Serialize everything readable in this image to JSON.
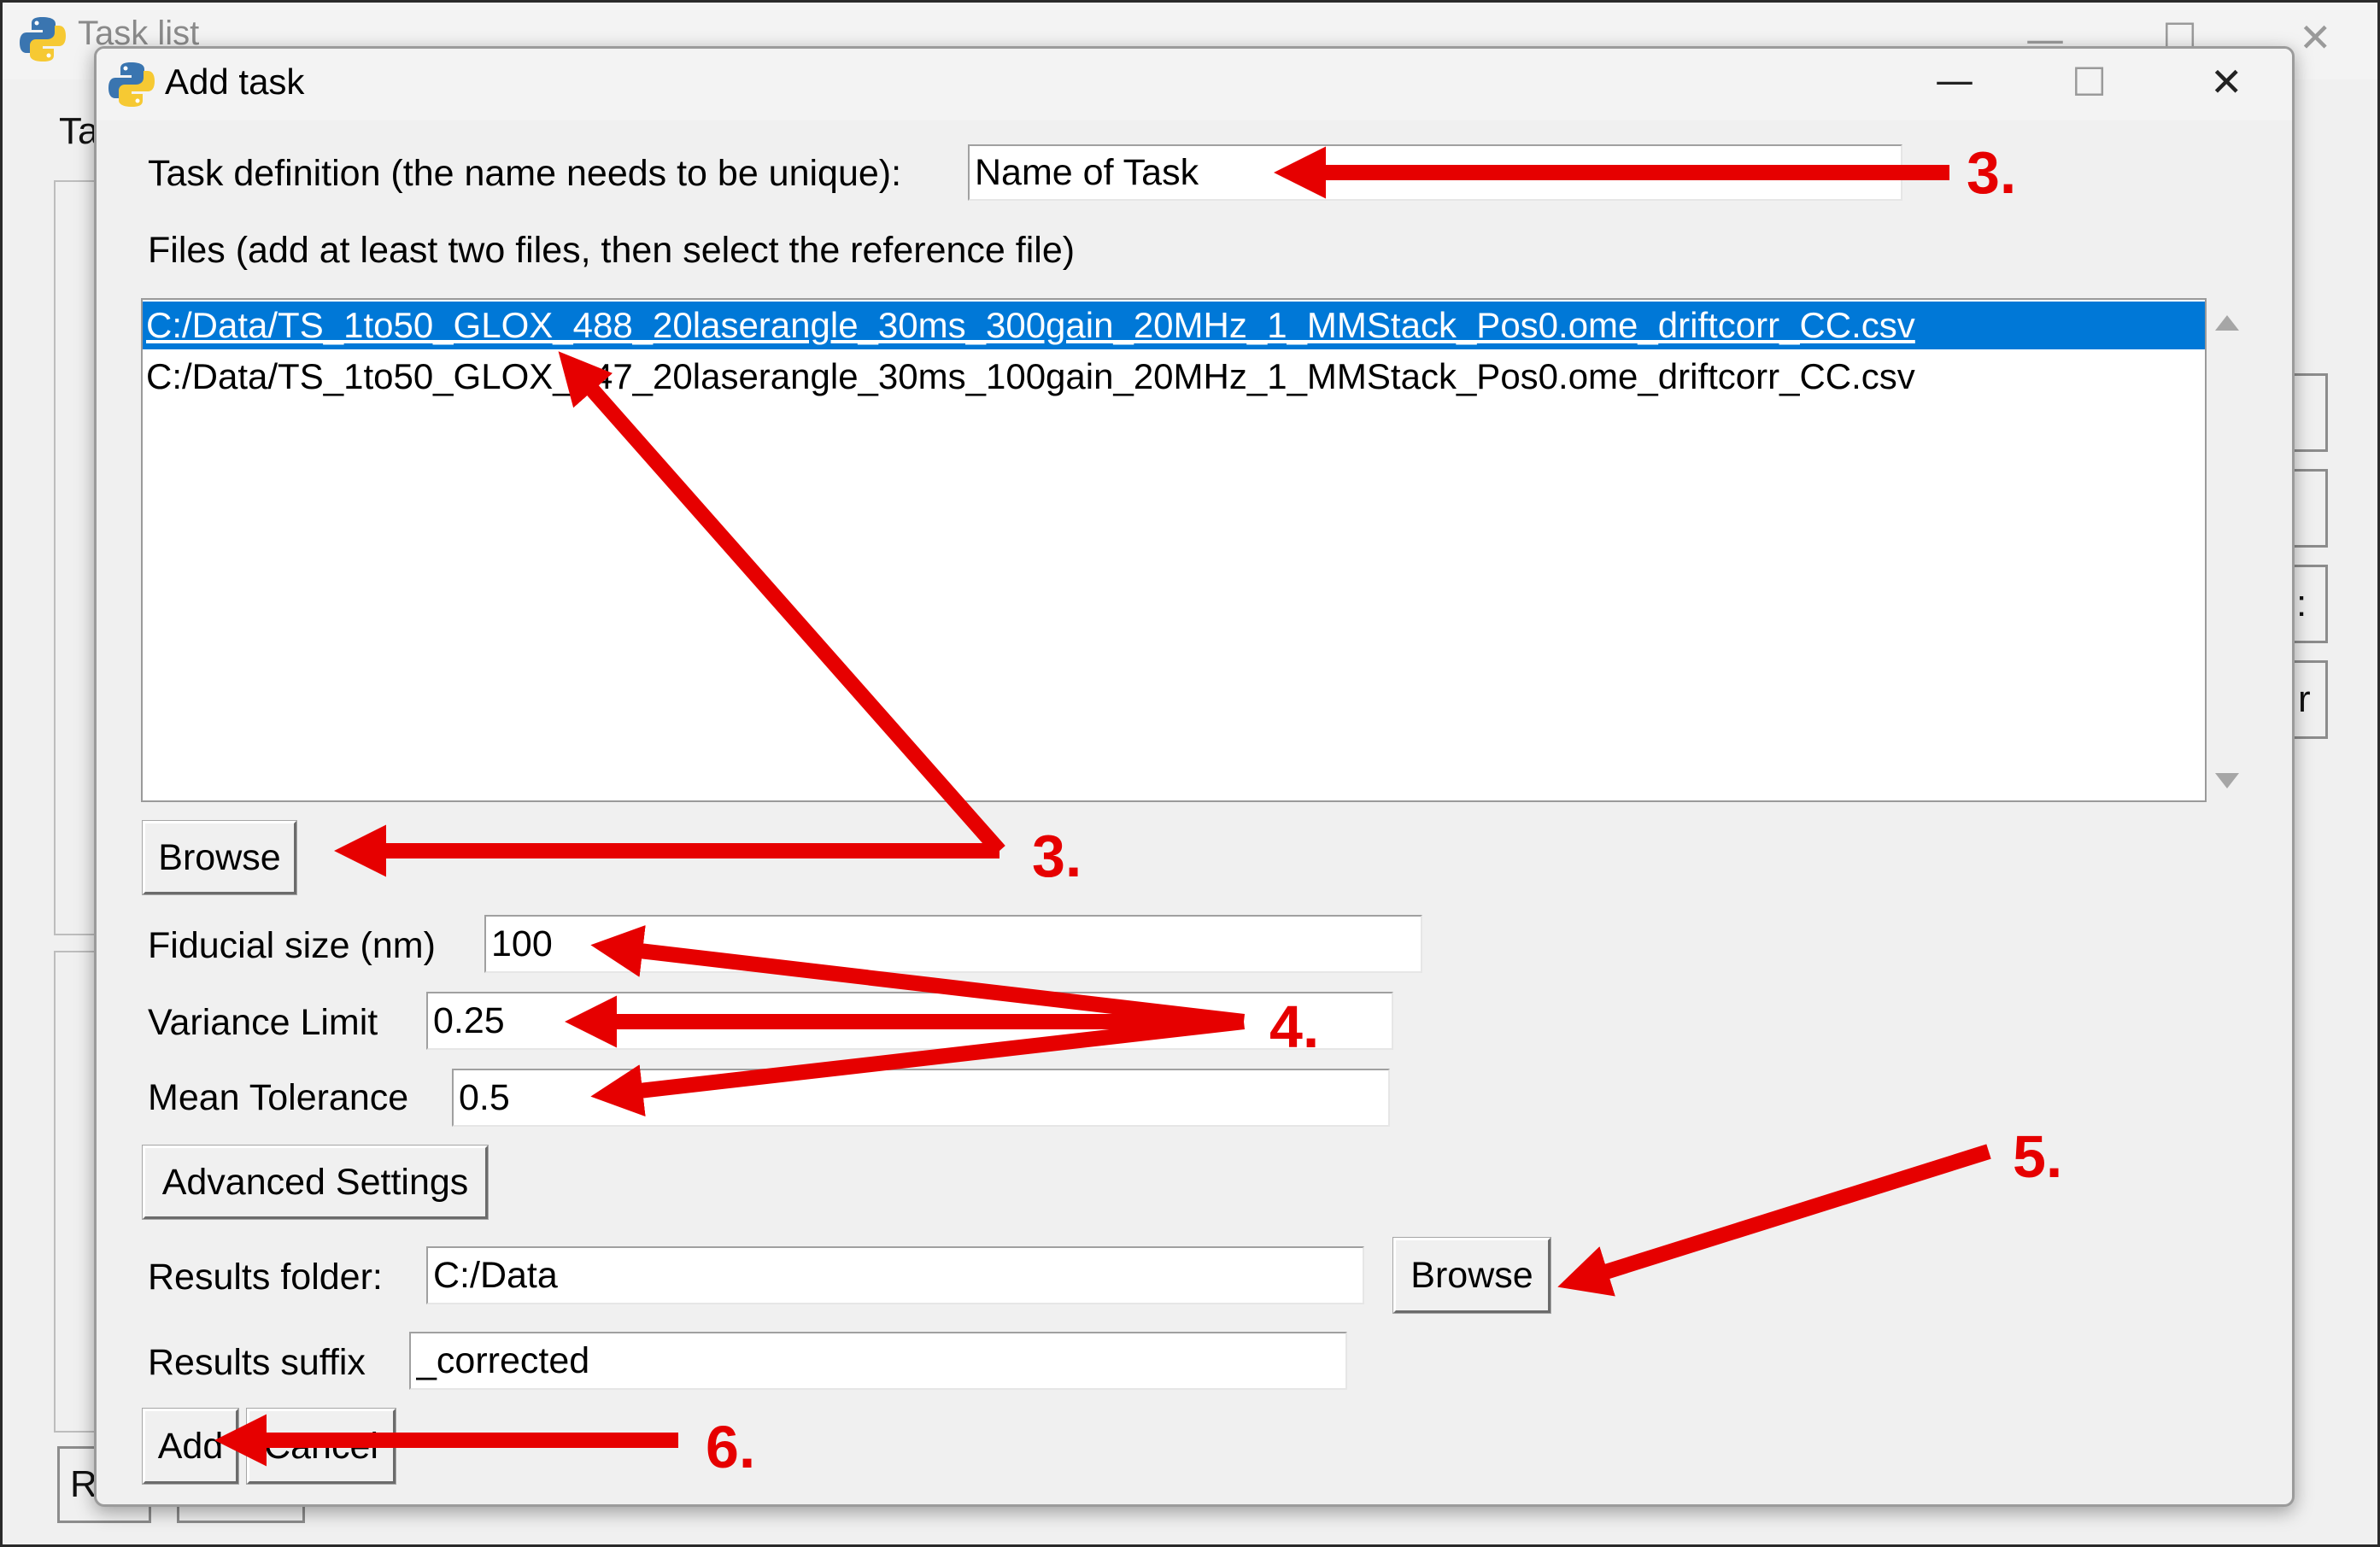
{
  "background_window": {
    "title": "Task list",
    "label_fragment": "Ta",
    "button_fragment_1": ":",
    "button_fragment_2": "r",
    "bottom_button_fragment": "Ru"
  },
  "dialog": {
    "title": "Add task",
    "controls": {
      "minimize": "—",
      "maximize": "☐",
      "close": "✕"
    }
  },
  "form": {
    "task_definition": {
      "label": "Task definition (the name needs to be unique):",
      "value": "Name of Task"
    },
    "files": {
      "label": "Files (add at least two files, then select the reference file)",
      "items": [
        {
          "path": "C:/Data/TS_1to50_GLOX_488_20laserangle_30ms_300gain_20MHz_1_MMStack_Pos0.ome_driftcorr_CC.csv",
          "selected": true
        },
        {
          "path": "C:/Data/TS_1to50_GLOX_647_20laserangle_30ms_100gain_20MHz_1_MMStack_Pos0.ome_driftcorr_CC.csv",
          "selected": false
        }
      ],
      "browse_label": "Browse"
    },
    "fiducial_size": {
      "label": "Fiducial size (nm)",
      "value": "100"
    },
    "variance_limit": {
      "label": "Variance Limit",
      "value": "0.25"
    },
    "mean_tolerance": {
      "label": "Mean Tolerance",
      "value": "0.5"
    },
    "advanced_settings_label": "Advanced Settings",
    "results_folder": {
      "label": "Results folder:",
      "value": "C:/Data",
      "browse_label": "Browse"
    },
    "results_suffix": {
      "label": "Results suffix",
      "value": "_corrected"
    },
    "add_label": "Add",
    "cancel_label": "Cancel"
  },
  "annotations": {
    "color": "#e60000",
    "steps": [
      "3.",
      "3.",
      "4.",
      "5.",
      "6."
    ]
  }
}
